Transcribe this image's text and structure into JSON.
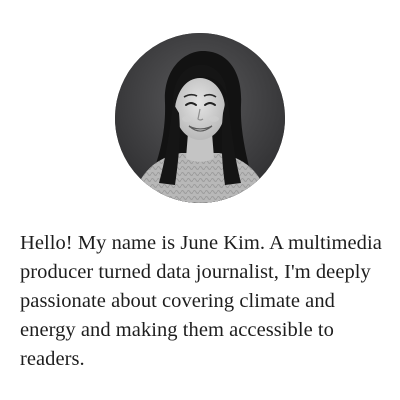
{
  "profile": {
    "bio": "Hello! My name is June Kim. A multimedia producer turned data journalist, I'm deeply passionate about covering climate and energy and making them accessible to readers.",
    "photo_subject": "smiling woman with long dark hair wearing a knit sweater"
  },
  "colors": {
    "background": "#ffffff",
    "photo_background": "#3b3b3d",
    "text": "#1d1d1d"
  }
}
